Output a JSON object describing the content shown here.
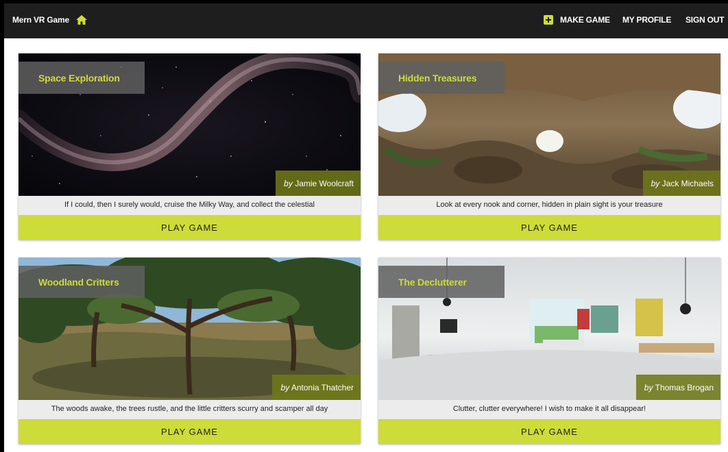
{
  "app": {
    "title": "Mern VR Game"
  },
  "nav": {
    "make_game": "MAKE GAME",
    "my_profile": "MY PROFILE",
    "sign_out": "SIGN OUT"
  },
  "games": [
    {
      "title": "Space Exploration",
      "by": "by",
      "author": "Jamie Woolcraft",
      "description": "If I could, then I surely would, cruise the Milky Way, and collect the celestial",
      "play": "PLAY GAME"
    },
    {
      "title": "Hidden Treasures",
      "by": "by",
      "author": "Jack Michaels",
      "description": "Look at every nook and corner, hidden in plain sight is your treasure",
      "play": "PLAY GAME"
    },
    {
      "title": "Woodland Critters",
      "by": "by",
      "author": "Antonia Thatcher",
      "description": "The woods awake, the trees rustle, and the little critters scurry and scamper all day",
      "play": "PLAY GAME"
    },
    {
      "title": "The Declutterer",
      "by": "by",
      "author": "Thomas Brogan",
      "description": "Clutter, clutter everywhere! I wish to make it all disappear!",
      "play": "PLAY GAME"
    }
  ],
  "colors": {
    "accent": "#cddc39",
    "topbar": "#1e1e1e"
  }
}
